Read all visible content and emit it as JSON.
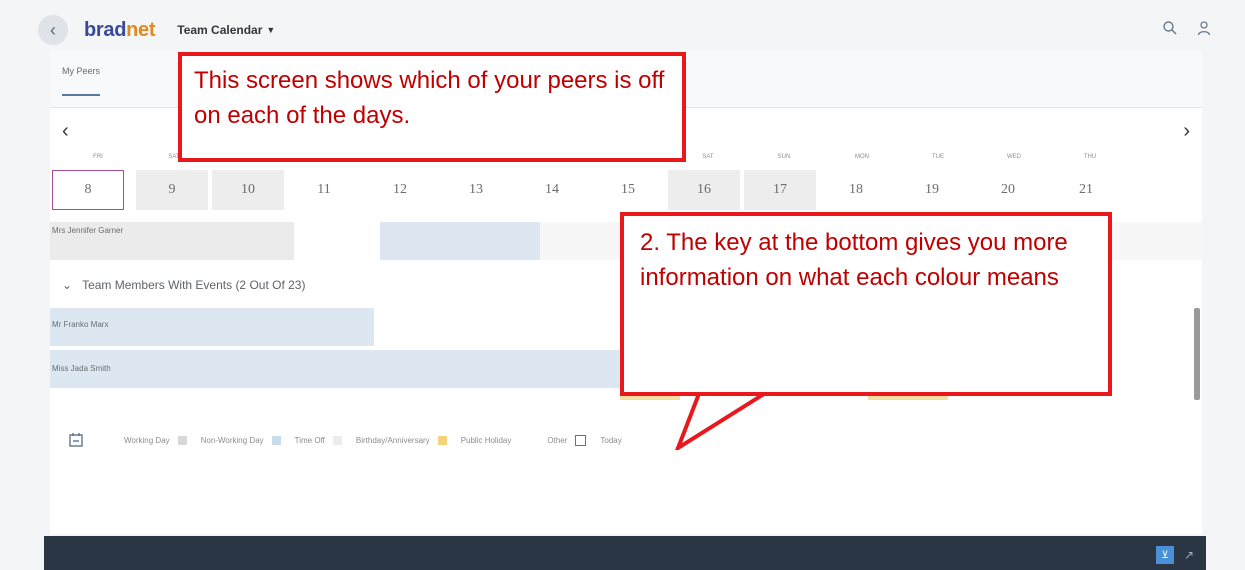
{
  "shell": {
    "back_glyph": "‹",
    "logo_part1": "brad",
    "logo_part2": "net",
    "app_title": "Team Calendar",
    "icons": [
      "search-icon",
      "user-icon"
    ]
  },
  "tabs": [
    {
      "label": "My Peers"
    }
  ],
  "calendar": {
    "day_names": [
      "FRI",
      "SAT",
      "",
      "",
      "",
      "",
      "",
      "",
      "SAT",
      "SUN",
      "MON",
      "TUE",
      "WED",
      "THU"
    ],
    "dates": [
      "8",
      "9",
      "10",
      "11",
      "12",
      "13",
      "14",
      "15",
      "16",
      "17",
      "18",
      "19",
      "20",
      "21"
    ],
    "today_index": 0,
    "prev_icon": "chevron-left-icon",
    "next_icon": "chevron-right-icon"
  },
  "rows": {
    "peer": "Mrs Jennifer Garner",
    "section_header": "Team Members With Events (2 Out Of 23)",
    "members": [
      "Mr Franko Marx",
      "Miss Jada Smith"
    ]
  },
  "legend": {
    "icon": "calendar-legend-icon",
    "items": [
      {
        "label": "Working Day",
        "color": "#d8d8d8"
      },
      {
        "label": "Non-Working Day",
        "color": "#c9dceb"
      },
      {
        "label": "Time Off",
        "color": "#ececec"
      },
      {
        "label": "Birthday/Anniversary",
        "color": "#f2d37a"
      },
      {
        "label": "Public Holiday",
        "color": ""
      },
      {
        "label": "Other",
        "color": "#a64d95"
      },
      {
        "label": "Today",
        "color": ""
      }
    ]
  },
  "toolbar": {
    "filter_icon": "filter-icon",
    "share_icon": "share-icon"
  },
  "annotations": {
    "callout1": "This screen shows which of your peers is off on each of the days.",
    "callout2": "2. The key at the bottom gives you more information on what each colour means"
  },
  "colors": {
    "accent": "#e8181c",
    "today_border": "#a64d95",
    "header_dark": "#2b3644"
  }
}
